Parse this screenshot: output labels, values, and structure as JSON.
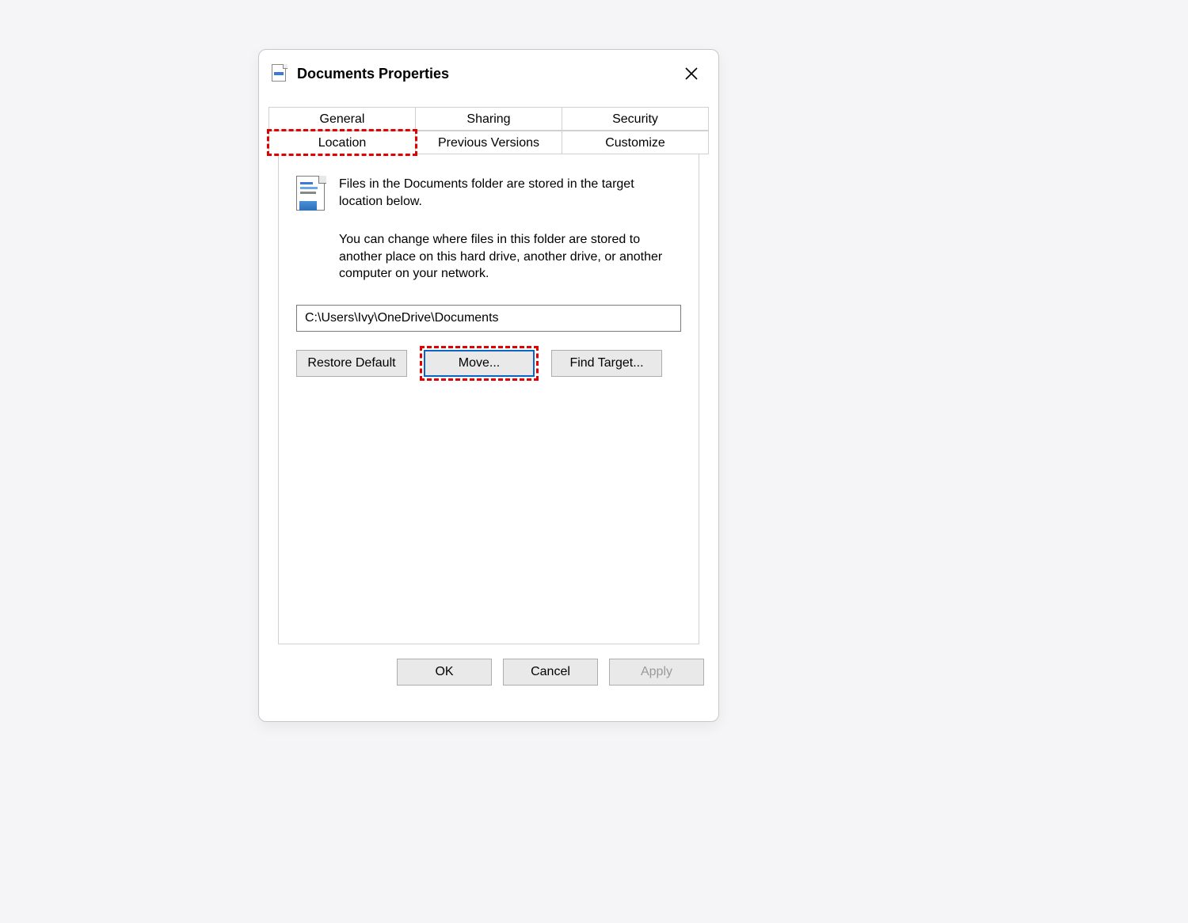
{
  "window": {
    "title": "Documents Properties"
  },
  "tabs": {
    "row1": [
      "General",
      "Sharing",
      "Security"
    ],
    "row2": [
      "Location",
      "Previous Versions",
      "Customize"
    ],
    "active": "Location"
  },
  "content": {
    "line1": "Files in the Documents folder are stored in the target location below.",
    "line2": "You can change where files in this folder are stored to another place on this hard drive, another drive, or another computer on your network.",
    "path": "C:\\Users\\Ivy\\OneDrive\\Documents",
    "buttons": {
      "restore": "Restore Default",
      "move": "Move...",
      "find": "Find Target..."
    }
  },
  "footer": {
    "ok": "OK",
    "cancel": "Cancel",
    "apply": "Apply"
  },
  "highlights": [
    "tab-location",
    "move-button"
  ]
}
